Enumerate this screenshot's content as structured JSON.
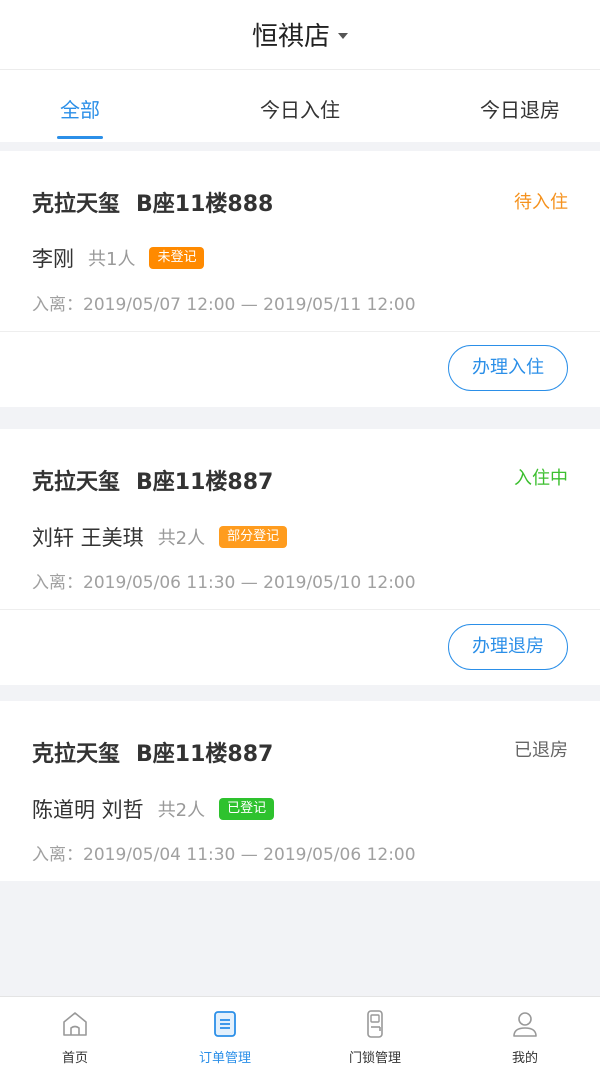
{
  "header": {
    "store_name": "恒祺店"
  },
  "tabs": [
    {
      "label": "全部",
      "active": true
    },
    {
      "label": "今日入住",
      "active": false
    },
    {
      "label": "今日退房",
      "active": false
    }
  ],
  "orders": [
    {
      "hotel": "克拉天玺",
      "room": "B座11楼888",
      "status": "待入住",
      "status_color": "#f5921e",
      "guests": "李刚",
      "count": "共1人",
      "registration": "未登记",
      "registration_color": "#ff8a00",
      "date_label": "入离：",
      "date_range": "2019/05/07 12:00 — 2019/05/11 12:00",
      "action": "办理入住"
    },
    {
      "hotel": "克拉天玺",
      "room": "B座11楼887",
      "status": "入住中",
      "status_color": "#3cbf2f",
      "guests": "刘轩 王美琪",
      "count": "共2人",
      "registration": "部分登记",
      "registration_color": "#ff9c1e",
      "date_label": "入离：",
      "date_range": "2019/05/06 11:30 — 2019/05/10 12:00",
      "action": "办理退房"
    },
    {
      "hotel": "克拉天玺",
      "room": "B座11楼887",
      "status": "已退房",
      "status_color": "#666666",
      "guests": "陈道明 刘哲",
      "count": "共2人",
      "registration": "已登记",
      "registration_color": "#2ec22e",
      "date_label": "入离：",
      "date_range": "2019/05/04 11:30 — 2019/05/06 12:00"
    }
  ],
  "bottom_nav": [
    {
      "label": "首页",
      "icon": "home-icon",
      "active": false
    },
    {
      "label": "订单管理",
      "icon": "order-icon",
      "active": true
    },
    {
      "label": "门锁管理",
      "icon": "door-lock-icon",
      "active": false
    },
    {
      "label": "我的",
      "icon": "user-icon",
      "active": false
    }
  ],
  "colors": {
    "accent": "#2b8fe8",
    "background": "#f2f3f6"
  }
}
